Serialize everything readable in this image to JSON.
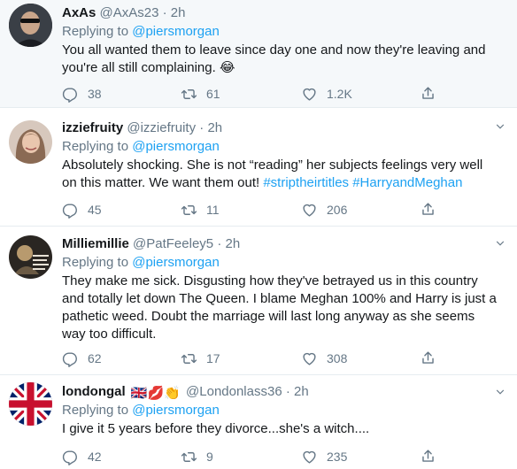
{
  "tweets": [
    {
      "name": "AxAs",
      "handle": "@AxAs23",
      "time": "2h",
      "replying_prefix": "Replying to",
      "replying_to": "@piersmorgan",
      "text": "You all wanted them to leave since day one and now they're leaving and you're all still complaining. 😂",
      "replies": "38",
      "retweets": "61",
      "likes": "1.2K"
    },
    {
      "name": "izziefruity",
      "handle": "@izziefruity",
      "time": "2h",
      "replying_prefix": "Replying to",
      "replying_to": "@piersmorgan",
      "text": "Absolutely shocking. She is not “reading” her subjects feelings very well on this matter. We want them out!",
      "hashtags": [
        "#striptheirtitles",
        "#HarryandMeghan"
      ],
      "replies": "45",
      "retweets": "11",
      "likes": "206"
    },
    {
      "name": "Milliemillie",
      "handle": "@PatFeeley5",
      "time": "2h",
      "replying_prefix": "Replying to",
      "replying_to": "@piersmorgan",
      "text": "They make me sick. Disgusting how they've betrayed us in this country and totally let down The Queen. I blame Meghan 100% and Harry is just a pathetic weed. Doubt the marriage will last long anyway as she seems way too difficult.",
      "replies": "62",
      "retweets": "17",
      "likes": "308"
    },
    {
      "name": "londongal",
      "name_emoji": "🇬🇧💋👏",
      "handle": "@Londonlass36",
      "time": "2h",
      "replying_prefix": "Replying to",
      "replying_to": "@piersmorgan",
      "text": "I give it 5 years before they divorce...she's a witch....",
      "replies": "42",
      "retweets": "9",
      "likes": "235"
    }
  ],
  "separator": "·",
  "colors": {
    "accent": "#1da1f2",
    "muted": "#657786",
    "highlight_bg": "#f5f8fa",
    "border": "#e6ecf0"
  },
  "icons": [
    "reply-icon",
    "retweet-icon",
    "like-icon",
    "share-icon",
    "caret-down-icon"
  ]
}
